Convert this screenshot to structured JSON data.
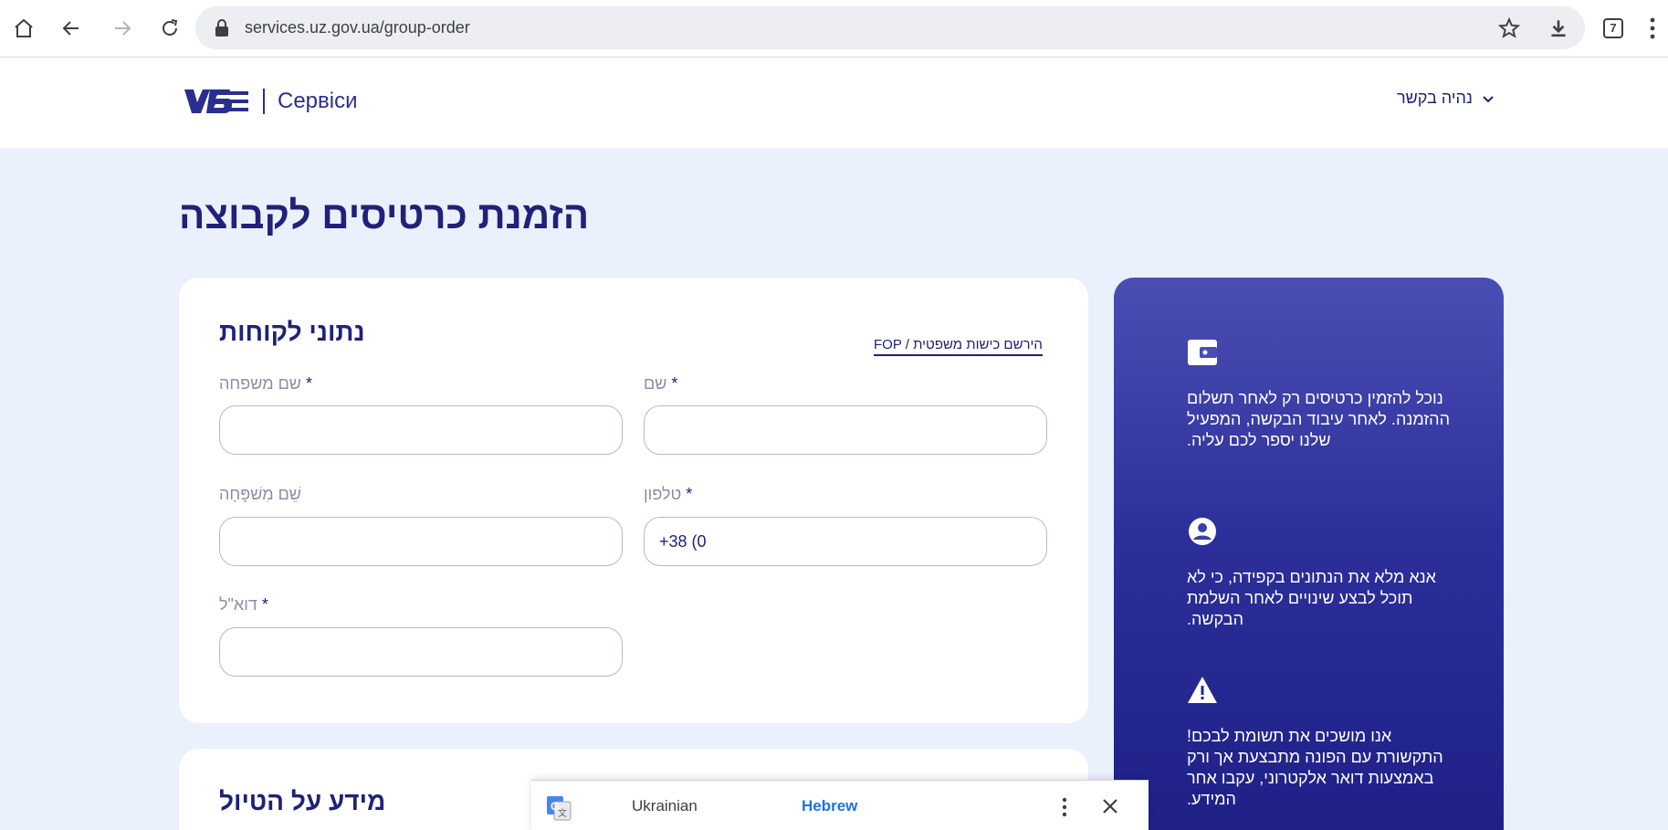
{
  "browser": {
    "url": "services.uz.gov.ua/group-order",
    "tab_count": "7"
  },
  "header": {
    "brand": "Сервіси",
    "language_toggle": "נהיה בקשר"
  },
  "page": {
    "title": "הזמנת כרטיסים לקבוצה"
  },
  "customer_form": {
    "title": "נתוני לקוחות",
    "fop_link": "FOP / הירשם כישות משפטית",
    "required_mark": "*",
    "fields": {
      "last_name": {
        "label": "שם משפחה",
        "value": ""
      },
      "first_name": {
        "label": "שם",
        "value": ""
      },
      "patronymic": {
        "label": "שֵׁם מִשׁפָּחָה",
        "value": ""
      },
      "phone": {
        "label": "טלפון",
        "value": "+38 (0"
      },
      "email": {
        "label": "דוא\"ל",
        "value": ""
      }
    }
  },
  "trip_section": {
    "title": "מידע על הטיול"
  },
  "info_panel": {
    "items": [
      {
        "icon": "wallet-icon",
        "text": "נוכל להזמין כרטיסים רק לאחר תשלום ההזמנה. לאחר עיבוד הבקשה, המפעיל שלנו יספר לכם עליה."
      },
      {
        "icon": "account-circle-icon",
        "text": "אנא מלא את הנתונים בקפידה, כי לא תוכל לבצע שינויים לאחר השלמת הבקשה."
      },
      {
        "icon": "warning-icon",
        "text": "אנו מושכים את תשומת לבכם! התקשורת עם הפונה מתבצעת אך ורק באמצעות דואר אלקטרוני, עקבו אחר המידע."
      }
    ]
  },
  "translate_bar": {
    "source_language": "Ukrainian",
    "target_language": "Hebrew"
  }
}
